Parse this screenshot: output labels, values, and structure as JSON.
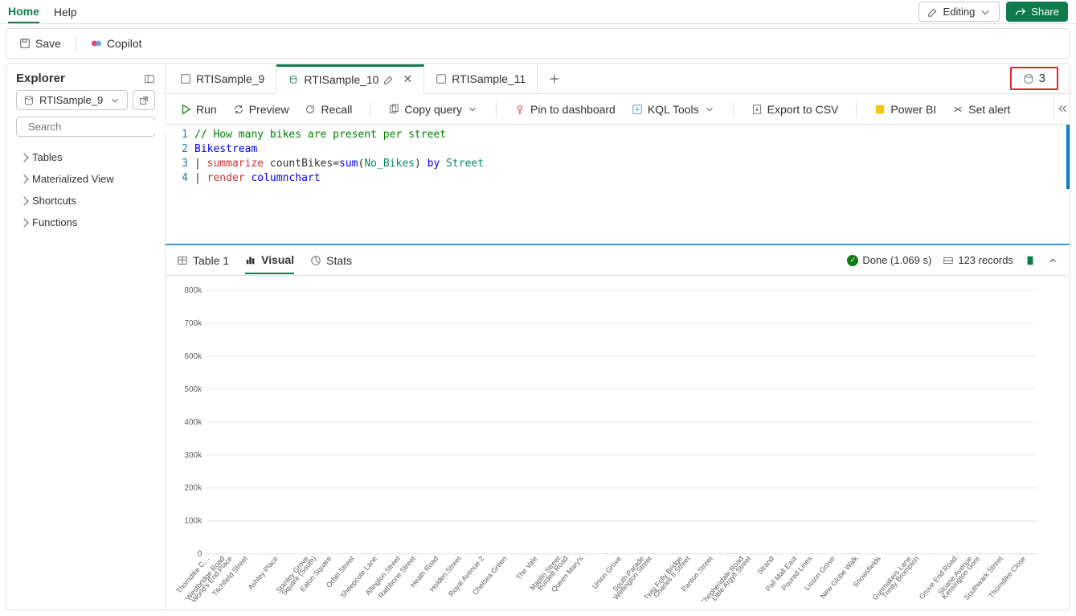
{
  "menu": {
    "home": "Home",
    "help": "Help",
    "editing": "Editing",
    "share": "Share"
  },
  "toolbar": {
    "save": "Save",
    "copilot": "Copilot"
  },
  "tabs": {
    "items": [
      {
        "label": "RTISample_9"
      },
      {
        "label": "RTISample_10"
      },
      {
        "label": "RTISample_11"
      }
    ],
    "counter": "3"
  },
  "actions": {
    "run": "Run",
    "preview": "Preview",
    "recall": "Recall",
    "copy_query": "Copy query",
    "pin": "Pin to dashboard",
    "kql_tools": "KQL Tools",
    "export_csv": "Export to CSV",
    "power_bi": "Power BI",
    "set_alert": "Set alert"
  },
  "explorer": {
    "title": "Explorer",
    "db": "RTISample_9",
    "search_placeholder": "Search",
    "nodes": {
      "tables": "Tables",
      "mat_view": "Materialized View",
      "shortcuts": "Shortcuts",
      "functions": "Functions"
    }
  },
  "editor": {
    "line1": "// How many bikes are present per street",
    "line2": "Bikestream",
    "line3_op": "summarize",
    "line3_assign": "countBikes=",
    "line3_fn": "sum",
    "line3_arg": "No_Bikes",
    "line3_by": "by",
    "line3_col": "Street",
    "line4_op": "render",
    "line4_arg": "columnchart"
  },
  "result": {
    "tab_table": "Table 1",
    "tab_visual": "Visual",
    "tab_stats": "Stats",
    "done": "Done (1.069 s)",
    "records": "123 records"
  },
  "chart_data": {
    "type": "bar",
    "ylabel": "",
    "xlabel": "",
    "ylim": [
      0,
      800000
    ],
    "yticks": [
      "0",
      "100k",
      "200k",
      "300k",
      "400k",
      "500k",
      "600k",
      "700k",
      "800k"
    ],
    "categories": [
      "Thorndike C…",
      "Westbridge Road",
      "World's End Place",
      "Titchfield Street",
      "",
      "",
      "Ashley Place",
      "",
      "Stanley Grove",
      "Square (South)",
      "Eaton Square",
      "",
      "Orbel Street",
      "",
      "Sheepcote Lane",
      "",
      "Allington Street",
      "Rathbone Street",
      "",
      "Heath Road",
      "",
      "Holden Street",
      "",
      "Royal Avenue 2",
      "",
      "Chelsea Green",
      "",
      "The Vale",
      "",
      "Maplin Street",
      "Burdett Road",
      "Queen Mary's",
      "",
      "",
      "Union Grove",
      "",
      "South Parade",
      "Wellington Street",
      "",
      "Twig Folly Bridge",
      "Charles II Street",
      "",
      "Panton Street",
      "",
      "Chephendale Road",
      "Little Argyll Street",
      "",
      "Strand",
      "",
      "Pall Mall East",
      "Poured Lines",
      "",
      "Lisson Grove",
      "",
      "New Globe Walk",
      "",
      "Snowsfields",
      "",
      "Gunmakers Lane",
      "Trinity Brompton",
      "",
      "",
      "Grove End Road",
      "Sloane Avenue",
      "Kensington Gore",
      "",
      "Southwark Street",
      "",
      "Thorndike Close"
    ],
    "values": [
      160,
      495,
      110,
      260,
      105,
      135,
      150,
      50,
      380,
      290,
      265,
      310,
      205,
      340,
      140,
      300,
      225,
      275,
      100,
      215,
      585,
      370,
      415,
      255,
      170,
      300,
      185,
      345,
      145,
      240,
      130,
      140,
      210,
      90,
      320,
      260,
      180,
      225,
      410,
      130,
      230,
      395,
      280,
      505,
      510,
      345,
      335,
      260,
      575,
      450,
      310,
      155,
      740,
      270,
      275,
      80,
      175,
      305,
      210,
      180,
      115,
      390,
      355,
      365,
      355,
      360,
      420,
      255,
      740,
      670,
      300,
      495,
      375,
      390,
      365,
      410,
      350,
      305,
      225,
      295,
      220,
      130,
      120,
      425,
      510,
      705,
      45,
      400,
      75,
      130,
      65,
      145,
      360,
      180,
      155,
      350,
      165,
      115,
      270,
      180,
      205,
      305,
      230,
      230,
      450,
      310,
      310,
      395,
      340
    ]
  }
}
